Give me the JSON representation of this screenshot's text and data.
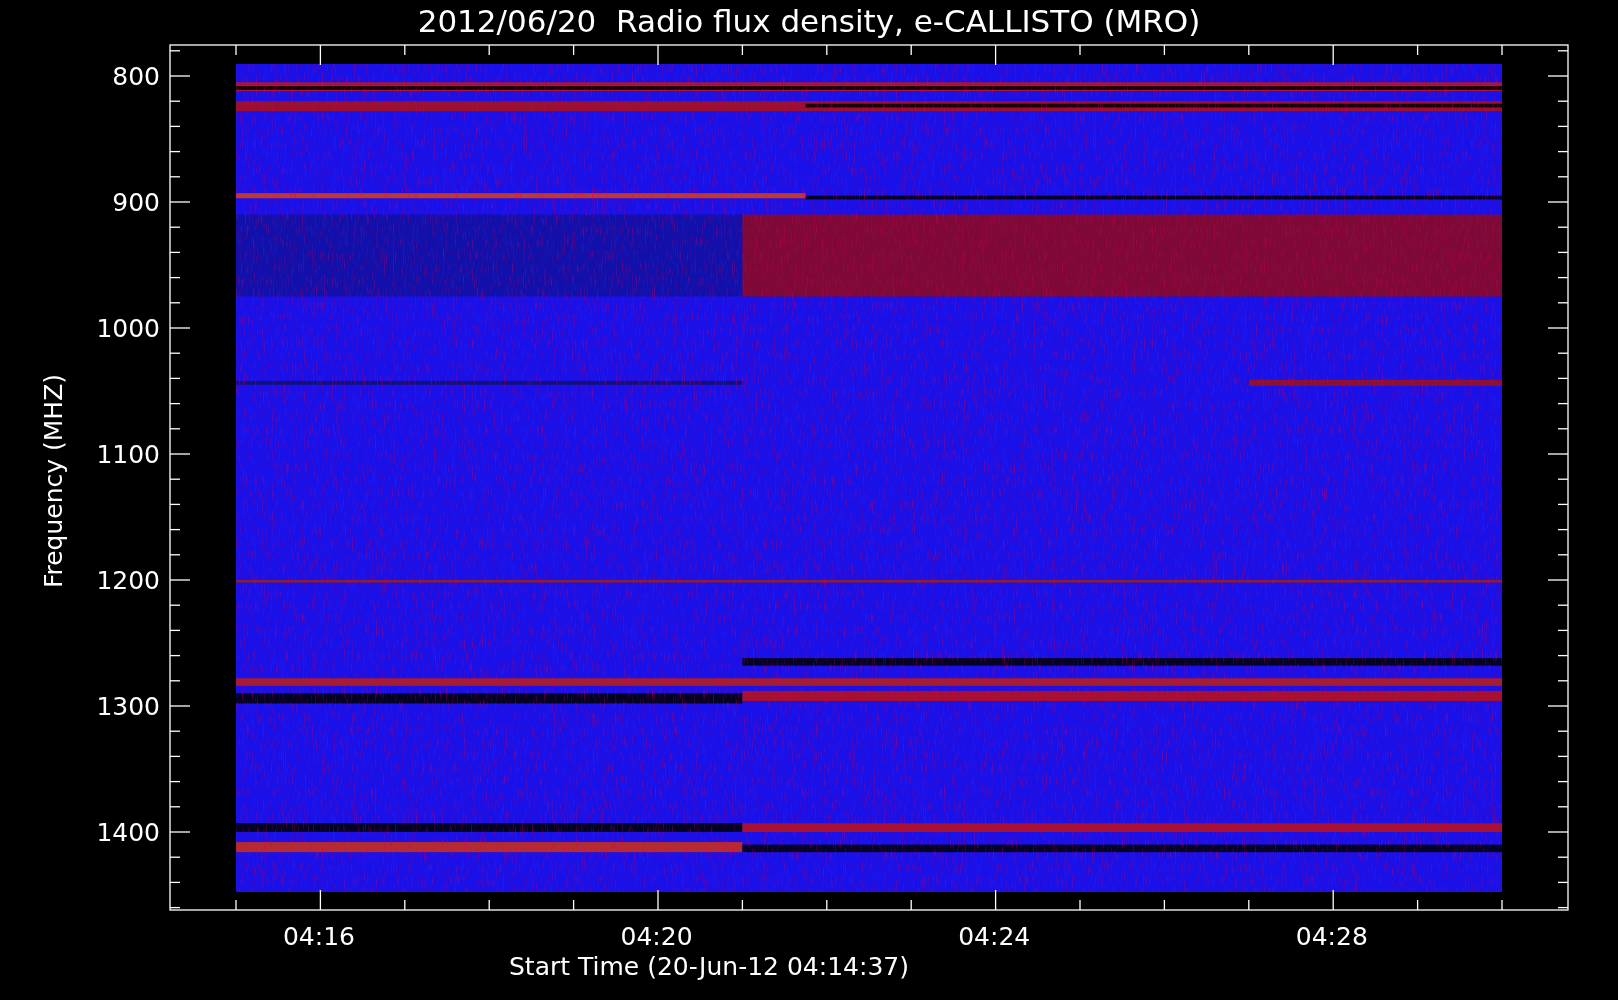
{
  "title": "2012/06/20  Radio flux density, e-CALLISTO (MRO)",
  "y_axis": {
    "label": "Frequency (MHZ)",
    "ticks": [
      "800",
      "900",
      "1000",
      "1100",
      "1200",
      "1300",
      "1400"
    ]
  },
  "x_axis": {
    "label": "Start Time (20-Jun-12 04:14:37)",
    "ticks": [
      "04:16",
      "04:20",
      "04:24",
      "04:28"
    ]
  }
}
